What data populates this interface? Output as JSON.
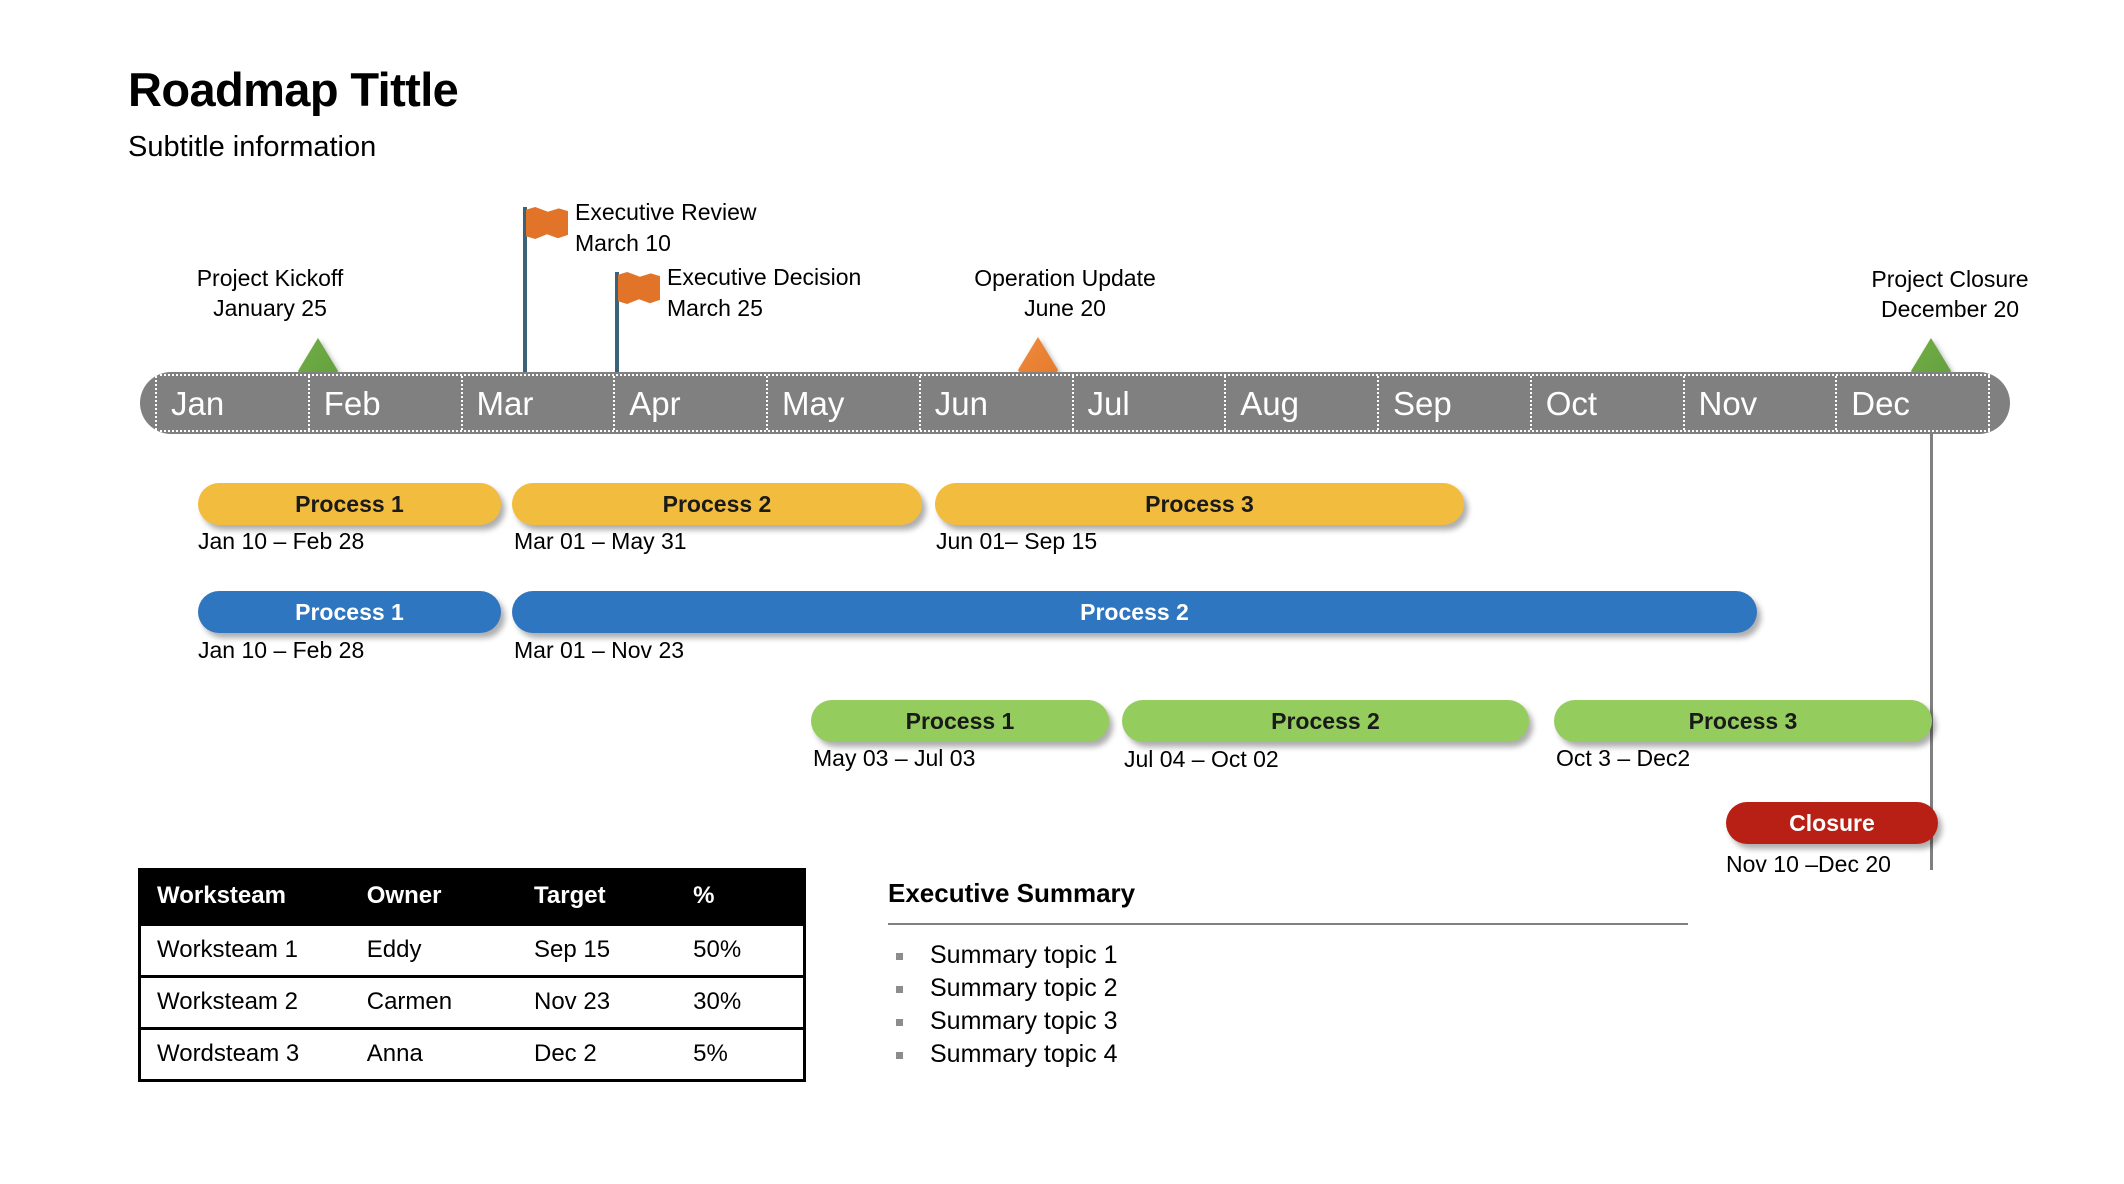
{
  "header": {
    "title": "Roadmap Tittle",
    "subtitle": "Subtitle information"
  },
  "timeline": {
    "months": [
      "Jan",
      "Feb",
      "Mar",
      "Apr",
      "May",
      "Jun",
      "Jul",
      "Aug",
      "Sep",
      "Oct",
      "Nov",
      "Dec"
    ],
    "band_color": "#808080",
    "label_color": "#ffffff"
  },
  "milestones": [
    {
      "name": "project-kickoff",
      "title": "Project Kickoff",
      "date": "January 25",
      "marker": "diamond",
      "color": "#5f9e3a"
    },
    {
      "name": "executive-review",
      "title": "Executive Review",
      "date": "March 10",
      "marker": "flag",
      "color": "#e2742a"
    },
    {
      "name": "executive-decision",
      "title": "Executive Decision",
      "date": "March 25",
      "marker": "flag",
      "color": "#e2742a"
    },
    {
      "name": "operation-update",
      "title": "Operation Update",
      "date": "June 20",
      "marker": "diamond",
      "color": "#e2742a"
    },
    {
      "name": "project-closure",
      "title": "Project Closure",
      "date": "December 20",
      "marker": "diamond",
      "color": "#5f9e3a"
    }
  ],
  "tracks": [
    {
      "name": "track-yellow",
      "color": "#f2bc3e",
      "bars": [
        {
          "label": "Process 1",
          "caption": "Jan 10 – Feb 28"
        },
        {
          "label": "Process 2",
          "caption": "Mar 01 – May 31"
        },
        {
          "label": "Process 3",
          "caption": "Jun 01– Sep 15"
        }
      ]
    },
    {
      "name": "track-blue",
      "color": "#2f76c0",
      "bars": [
        {
          "label": "Process 1",
          "caption": "Jan 10 – Feb 28"
        },
        {
          "label": "Process 2",
          "caption": "Mar 01 – Nov 23"
        }
      ]
    },
    {
      "name": "track-green",
      "color": "#95cc5e",
      "bars": [
        {
          "label": "Process 1",
          "caption": "May 03 – Jul 03"
        },
        {
          "label": "Process 2",
          "caption": "Jul 04 – Oct 02"
        },
        {
          "label": "Process 3",
          "caption": "Oct 3 – Dec2"
        }
      ]
    },
    {
      "name": "track-red",
      "color": "#b92015",
      "bars": [
        {
          "label": "Closure",
          "caption": "Nov 10 –Dec 20"
        }
      ]
    }
  ],
  "table": {
    "headers": [
      "Worksteam",
      "Owner",
      "Target",
      "%"
    ],
    "rows": [
      [
        "Worksteam 1",
        "Eddy",
        "Sep 15",
        "50%"
      ],
      [
        "Worksteam 2",
        "Carmen",
        "Nov 23",
        "30%"
      ],
      [
        "Wordsteam 3",
        "Anna",
        "Dec 2",
        "5%"
      ]
    ]
  },
  "executive_summary": {
    "title": "Executive Summary",
    "items": [
      "Summary topic 1",
      "Summary topic 2",
      "Summary topic 3",
      "Summary topic 4"
    ]
  }
}
